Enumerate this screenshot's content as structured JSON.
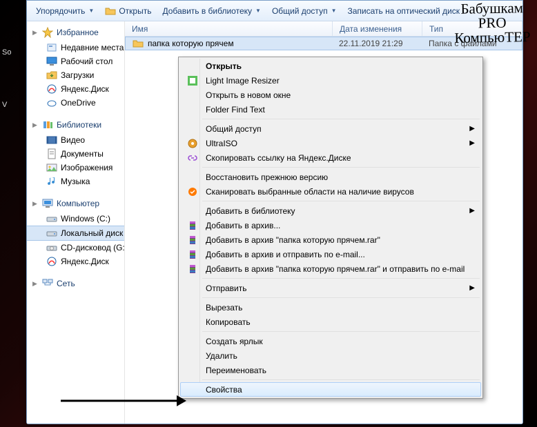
{
  "toolbar": {
    "organize": "Упорядочить",
    "open": "Открыть",
    "addToLibrary": "Добавить в библиотеку",
    "share": "Общий доступ",
    "burn": "Записать на оптический диск"
  },
  "nav": {
    "favorites": {
      "label": "Избранное",
      "items": [
        {
          "label": "Недавние места",
          "icon": "recent"
        },
        {
          "label": "Рабочий стол",
          "icon": "desktop"
        },
        {
          "label": "Загрузки",
          "icon": "downloads"
        },
        {
          "label": "Яндекс.Диск",
          "icon": "yadisk"
        },
        {
          "label": "OneDrive",
          "icon": "onedrive"
        }
      ]
    },
    "libraries": {
      "label": "Библиотеки",
      "items": [
        {
          "label": "Видео",
          "icon": "video"
        },
        {
          "label": "Документы",
          "icon": "docs"
        },
        {
          "label": "Изображения",
          "icon": "pictures"
        },
        {
          "label": "Музыка",
          "icon": "music"
        }
      ]
    },
    "computer": {
      "label": "Компьютер",
      "items": [
        {
          "label": "Windows (C:)",
          "icon": "drive"
        },
        {
          "label": "Локальный диск",
          "icon": "drive",
          "selected": true
        },
        {
          "label": "CD-дисковод (G:)",
          "icon": "cd"
        },
        {
          "label": "Яндекс.Диск",
          "icon": "yadisk"
        }
      ]
    },
    "network": {
      "label": "Сеть"
    }
  },
  "columns": {
    "name": "Имя",
    "date": "Дата изменения",
    "type": "Тип"
  },
  "files": [
    {
      "name": "папка которую прячем",
      "date": "22.11.2019 21:29",
      "type": "Папка с файлами",
      "selected": true
    }
  ],
  "ctx": [
    {
      "label": "Открыть",
      "bold": true
    },
    {
      "label": "Light Image Resizer",
      "icon": "lir"
    },
    {
      "label": "Открыть в новом окне"
    },
    {
      "label": "Folder Find Text"
    },
    {
      "sep": true
    },
    {
      "label": "Общий доступ",
      "submenu": true
    },
    {
      "label": "UltraISO",
      "icon": "uiso",
      "submenu": true
    },
    {
      "label": "Скопировать ссылку на Яндекс.Диске",
      "icon": "link"
    },
    {
      "sep": true
    },
    {
      "label": "Восстановить прежнюю версию"
    },
    {
      "label": "Сканировать выбранные области на наличие вирусов",
      "icon": "avast"
    },
    {
      "sep": true
    },
    {
      "label": "Добавить в библиотеку",
      "submenu": true
    },
    {
      "label": "Добавить в архив...",
      "icon": "rar"
    },
    {
      "label": "Добавить в архив \"папка которую прячем.rar\"",
      "icon": "rar"
    },
    {
      "label": "Добавить в архив и отправить по e-mail...",
      "icon": "rar"
    },
    {
      "label": "Добавить в архив \"папка которую прячем.rar\" и отправить по e-mail",
      "icon": "rar"
    },
    {
      "sep": true
    },
    {
      "label": "Отправить",
      "submenu": true
    },
    {
      "sep": true
    },
    {
      "label": "Вырезать"
    },
    {
      "label": "Копировать"
    },
    {
      "sep": true
    },
    {
      "label": "Создать ярлык"
    },
    {
      "label": "Удалить"
    },
    {
      "label": "Переименовать"
    },
    {
      "sep": true
    },
    {
      "label": "Свойства",
      "hover": true
    }
  ],
  "watermark": {
    "l1": "Бабушкам",
    "l2": "PRO",
    "l3": "КомпьюТЕР"
  }
}
